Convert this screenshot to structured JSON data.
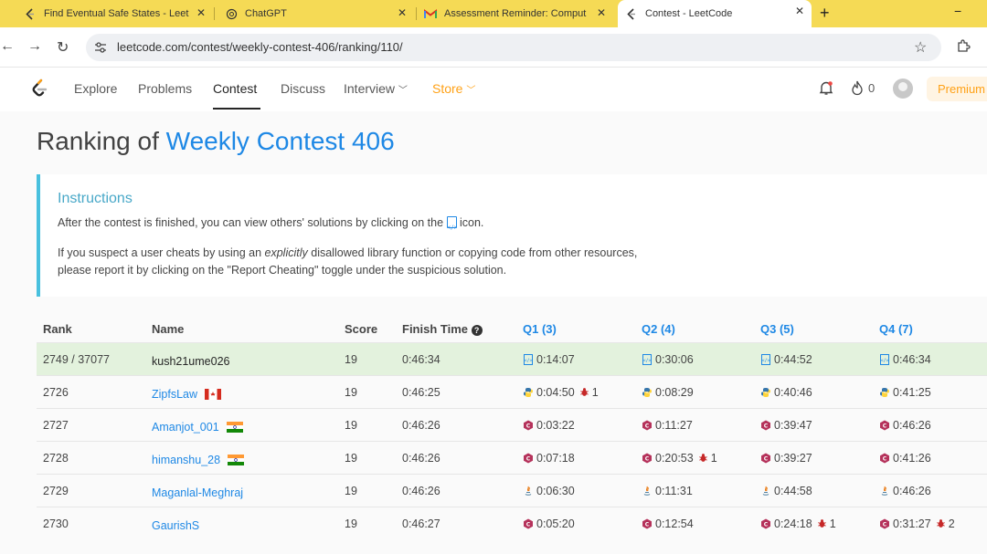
{
  "browser": {
    "tabs": [
      {
        "title": "Find Eventual Safe States - Leet",
        "icon": "leetcode-icon"
      },
      {
        "title": "ChatGPT",
        "icon": "chatgpt-icon"
      },
      {
        "title": "Assessment Reminder: Comput",
        "icon": "gmail-icon"
      },
      {
        "title": "Contest - LeetCode",
        "icon": "leetcode-icon",
        "active": true
      }
    ],
    "new_tab": "+",
    "minimize": "−",
    "url": "leetcode.com/contest/weekly-contest-406/ranking/110/"
  },
  "nav": {
    "items": [
      "Explore",
      "Problems",
      "Contest",
      "Discuss",
      "Interview",
      "Store"
    ],
    "active": "Contest",
    "fire_count": "0",
    "premium": "Premium"
  },
  "page": {
    "title_prefix": "Ranking of ",
    "title_contest": "Weekly Contest 406",
    "instructions": {
      "heading": "Instructions",
      "line1_before": "After the contest is finished, you can view others' solutions by clicking on the ",
      "line1_after": " icon.",
      "line2_a": "If you suspect a user cheats by using an ",
      "line2_em": "explicitly",
      "line2_b": " disallowed library function or copying code from other resources,",
      "line3": "please report it by clicking on the \"Report Cheating\" toggle under the suspicious solution."
    }
  },
  "table": {
    "headers": {
      "rank": "Rank",
      "name": "Name",
      "score": "Score",
      "finish": "Finish Time",
      "q1": "Q1 (3)",
      "q2": "Q2 (4)",
      "q3": "Q3 (5)",
      "q4": "Q4 (7)"
    },
    "rows": [
      {
        "rank": "2749 / 37077",
        "name": "kush21ume026",
        "score": "19",
        "finish": "0:46:34",
        "lang": "doc",
        "q": [
          {
            "t": "0:14:07"
          },
          {
            "t": "0:30:06"
          },
          {
            "t": "0:44:52"
          },
          {
            "t": "0:46:34"
          }
        ]
      },
      {
        "rank": "2726",
        "name": "ZipfsLaw",
        "flag": "canada",
        "score": "19",
        "finish": "0:46:25",
        "lang": "python",
        "q": [
          {
            "t": "0:04:50",
            "bug": "1"
          },
          {
            "t": "0:08:29"
          },
          {
            "t": "0:40:46"
          },
          {
            "t": "0:41:25"
          }
        ]
      },
      {
        "rank": "2727",
        "name": "Amanjot_001",
        "flag": "india",
        "score": "19",
        "finish": "0:46:26",
        "lang": "cpp",
        "q": [
          {
            "t": "0:03:22"
          },
          {
            "t": "0:11:27"
          },
          {
            "t": "0:39:47"
          },
          {
            "t": "0:46:26"
          }
        ]
      },
      {
        "rank": "2728",
        "name": "himanshu_28",
        "flag": "india",
        "score": "19",
        "finish": "0:46:26",
        "lang": "cpp",
        "q": [
          {
            "t": "0:07:18"
          },
          {
            "t": "0:20:53",
            "bug": "1"
          },
          {
            "t": "0:39:27"
          },
          {
            "t": "0:41:26"
          }
        ]
      },
      {
        "rank": "2729",
        "name": "Maganlal-Meghraj",
        "score": "19",
        "finish": "0:46:26",
        "lang": "java",
        "q": [
          {
            "t": "0:06:30"
          },
          {
            "t": "0:11:31"
          },
          {
            "t": "0:44:58"
          },
          {
            "t": "0:46:26"
          }
        ]
      },
      {
        "rank": "2730",
        "name": "GaurishS",
        "score": "19",
        "finish": "0:46:27",
        "lang": "cpp",
        "q": [
          {
            "t": "0:05:20"
          },
          {
            "t": "0:12:54"
          },
          {
            "t": "0:24:18",
            "bug": "1"
          },
          {
            "t": "0:31:27",
            "bug": "2"
          }
        ]
      }
    ]
  }
}
